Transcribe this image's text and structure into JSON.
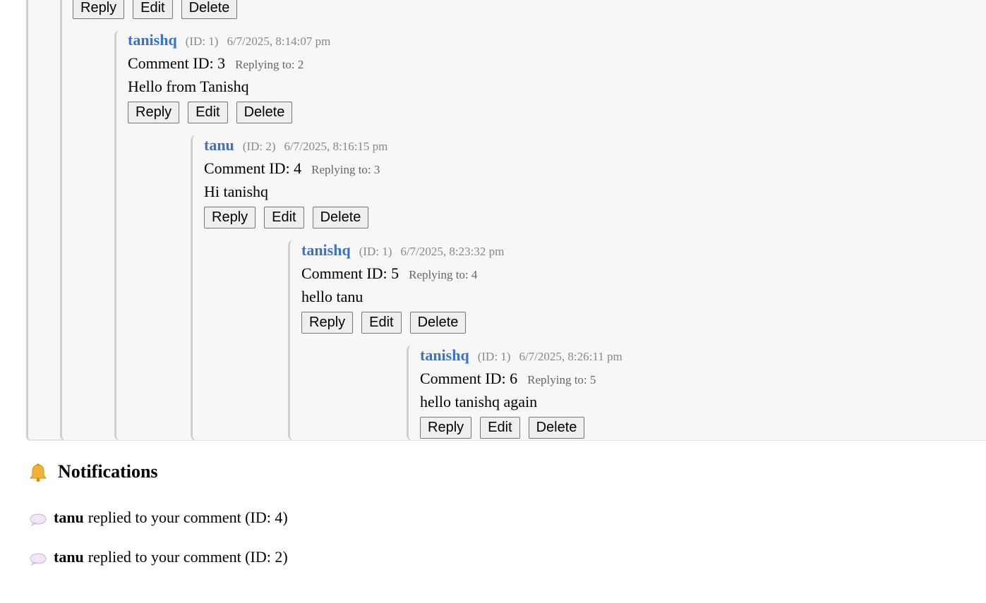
{
  "buttons": {
    "reply": "Reply",
    "edit": "Edit",
    "delete": "Delete"
  },
  "comments": [
    {
      "author": "tanishq",
      "uid": "(ID: 1)",
      "time": "6/7/2025, 8:14:07 pm",
      "id_label": "Comment ID: 3",
      "replying": "Replying to: 2",
      "text": "Hello from Tanishq"
    },
    {
      "author": "tanu",
      "uid": "(ID: 2)",
      "time": "6/7/2025, 8:16:15 pm",
      "id_label": "Comment ID: 4",
      "replying": "Replying to: 3",
      "text": "Hi tanishq"
    },
    {
      "author": "tanishq",
      "uid": "(ID: 1)",
      "time": "6/7/2025, 8:23:32 pm",
      "id_label": "Comment ID: 5",
      "replying": "Replying to: 4",
      "text": "hello tanu"
    },
    {
      "author": "tanishq",
      "uid": "(ID: 1)",
      "time": "6/7/2025, 8:26:11 pm",
      "id_label": "Comment ID: 6",
      "replying": "Replying to: 5",
      "text": "hello tanishq again"
    }
  ],
  "notifications": {
    "title": "Notifications",
    "icon": "bell-icon",
    "items": [
      {
        "icon": "speech-bubble-icon",
        "user": "tanu",
        "text": "replied to your comment (ID: 4)"
      },
      {
        "icon": "speech-bubble-icon",
        "user": "tanu",
        "text": "replied to your comment (ID: 2)"
      }
    ]
  }
}
